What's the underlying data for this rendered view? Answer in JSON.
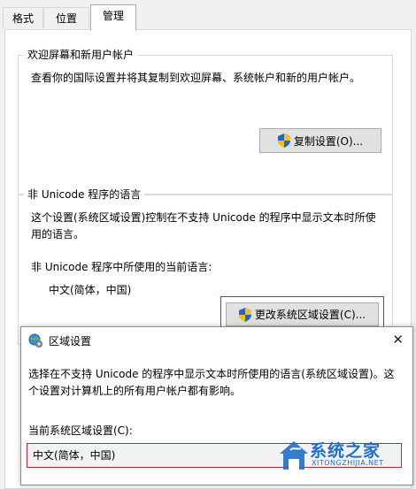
{
  "tabs": [
    {
      "label": "格式"
    },
    {
      "label": "位置"
    },
    {
      "label": "管理"
    }
  ],
  "welcome_group": {
    "title": "欢迎屏幕和新用户帐户",
    "description": "查看你的国际设置并将其复制到欢迎屏幕、系统帐户和新的用户帐户。",
    "copy_button": "复制设置(O)..."
  },
  "unicode_group": {
    "title": "非 Unicode 程序的语言",
    "description_line1": "这个设置(系统区域设置)控制在不支持 Unicode 的程序中显示文本时所使",
    "description_line2": "用的语言。",
    "current_label": "非 Unicode 程序中所使用的当前语言:",
    "current_value": "中文(简体，中国)",
    "change_button": "更改系统区域设置(C)..."
  },
  "dialog": {
    "title": "区域设置",
    "close_glyph": "✕",
    "description_line1": "选择在不支持 Unicode 的程序中显示文本时所使用的语言(系统区域设置)。这",
    "description_line2": "个设置对计算机上的所有用户帐户都有影响。",
    "locale_label": "当前系统区域设置(C):",
    "locale_value": "中文(简体，中国)"
  },
  "watermark": {
    "line1": "系统之家",
    "line2": "XITONGZHIJIA.NET"
  },
  "colors": {
    "highlight": "#c0262c",
    "watermark_blue": "#1f6fc9",
    "watermark_magenta": "#c8287a"
  }
}
